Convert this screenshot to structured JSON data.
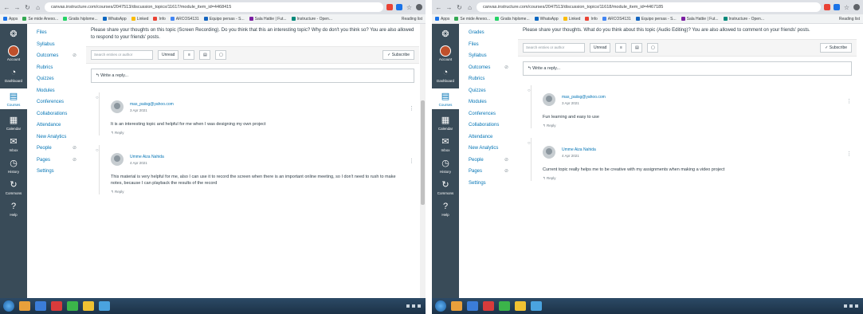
{
  "screens": [
    {
      "url": "canvas.instructure.com/courses/2047513/discussion_topics/11617/module_item_id=4468415",
      "bookmarks": [
        "Apps",
        "Se mide Anexo...",
        "Gratis hiplome...",
        "WhatsApp",
        "Linked",
        "Info",
        "ARCOS4131",
        "Equipo persas - S...",
        "Sala Hattie | Fut...",
        "Instructure - Open..."
      ],
      "bookmarks_more": "Reading list",
      "global_nav": [
        {
          "label": "",
          "icon": "canvas-logo"
        },
        {
          "label": "Account",
          "icon": "avatar"
        },
        {
          "label": "Dashboard",
          "icon": "dashboard"
        },
        {
          "label": "Courses",
          "icon": "courses"
        },
        {
          "label": "Calendar",
          "icon": "calendar"
        },
        {
          "label": "Inbox",
          "icon": "inbox"
        },
        {
          "label": "History",
          "icon": "history"
        },
        {
          "label": "Commons",
          "icon": "commons"
        },
        {
          "label": "Help",
          "icon": "help"
        }
      ],
      "course_nav": [
        {
          "label": "Files",
          "hidden": false
        },
        {
          "label": "Syllabus",
          "hidden": false
        },
        {
          "label": "Outcomes",
          "hidden": true
        },
        {
          "label": "Rubrics",
          "hidden": false
        },
        {
          "label": "Quizzes",
          "hidden": false
        },
        {
          "label": "Modules",
          "hidden": false
        },
        {
          "label": "Conferences",
          "hidden": false
        },
        {
          "label": "Collaborations",
          "hidden": false
        },
        {
          "label": "Attendance",
          "hidden": false
        },
        {
          "label": "New Analytics",
          "hidden": false
        },
        {
          "label": "People",
          "hidden": true
        },
        {
          "label": "Pages",
          "hidden": true
        },
        {
          "label": "Settings",
          "hidden": false
        }
      ],
      "prompt": "Please share your thoughts on this topic (Screen Recording). Do you think that this an interesting topic? Why do don't you think so? You are also allowed to respond to your friends' posts.",
      "search_placeholder": "Search entries or author",
      "unread_label": "Unread",
      "subscribe_label": "Subscribe",
      "reply_placeholder": "Write a reply...",
      "entries": [
        {
          "author": "mas_paiisg@yahoo.com",
          "date": "3 Apr 2021",
          "text": "It is an interesting topic and helpful for me when I was designing my own project",
          "reply": "Reply"
        },
        {
          "author": "Umme Aiza Nahida",
          "date": "4 Apr 2021",
          "text": "This material is very helpful for me, also I can use it to record the screen when there is an important online meeting, so I don't need to rush to make notes, because I can playback the results of the record",
          "reply": "Reply"
        }
      ],
      "scroll_thumb": {
        "top": 0.28,
        "size": 0.38
      }
    },
    {
      "url": "canvas.instructure.com/courses/2047513/discussion_topics/11618/module_item_id=4467185",
      "bookmarks": [
        "Apps",
        "Se mide Anexo...",
        "Gratis hiplome...",
        "WhatsApp",
        "Linked",
        "Info",
        "ARCOS4131",
        "Equipo persas - S...",
        "Sala Hattie | Fut...",
        "Instructure - Open..."
      ],
      "bookmarks_more": "Reading list",
      "global_nav": [
        {
          "label": "",
          "icon": "canvas-logo"
        },
        {
          "label": "Account",
          "icon": "avatar"
        },
        {
          "label": "Dashboard",
          "icon": "dashboard"
        },
        {
          "label": "Courses",
          "icon": "courses"
        },
        {
          "label": "Calendar",
          "icon": "calendar"
        },
        {
          "label": "Inbox",
          "icon": "inbox"
        },
        {
          "label": "History",
          "icon": "history"
        },
        {
          "label": "Commons",
          "icon": "commons"
        },
        {
          "label": "Help",
          "icon": "help"
        }
      ],
      "course_nav": [
        {
          "label": "Grades",
          "hidden": false
        },
        {
          "label": "Files",
          "hidden": false
        },
        {
          "label": "Syllabus",
          "hidden": false
        },
        {
          "label": "Outcomes",
          "hidden": true
        },
        {
          "label": "Rubrics",
          "hidden": false
        },
        {
          "label": "Quizzes",
          "hidden": false
        },
        {
          "label": "Modules",
          "hidden": false
        },
        {
          "label": "Conferences",
          "hidden": false
        },
        {
          "label": "Collaborations",
          "hidden": false
        },
        {
          "label": "Attendance",
          "hidden": false
        },
        {
          "label": "New Analytics",
          "hidden": false
        },
        {
          "label": "People",
          "hidden": true
        },
        {
          "label": "Pages",
          "hidden": true
        },
        {
          "label": "Settings",
          "hidden": false
        }
      ],
      "prompt": "Please share your thoughts. What do you think about this topic (Audio Editing)? You are also allowed to comment on your friends' posts.",
      "search_placeholder": "Search entries or author",
      "unread_label": "Unread",
      "subscribe_label": "Subscribe",
      "reply_placeholder": "Write a reply...",
      "entries": [
        {
          "author": "mas_paiisg@yahoo.com",
          "date": "3 Apr 2021",
          "text": "Fun learning and easy to use",
          "reply": "Reply"
        },
        {
          "author": "Umme Aiza Nahida",
          "date": "4 Apr 2021",
          "text": "Current topic really helps me to be creative with my assignments when making a video project",
          "reply": "Reply"
        }
      ],
      "scroll_thumb": {
        "top": 0.0,
        "size": 0.0
      }
    }
  ],
  "colors": {
    "global_nav": "#394b58",
    "link": "#0374b5",
    "tab_strip": "#dee1e6",
    "taskbar": "#1c3247"
  }
}
